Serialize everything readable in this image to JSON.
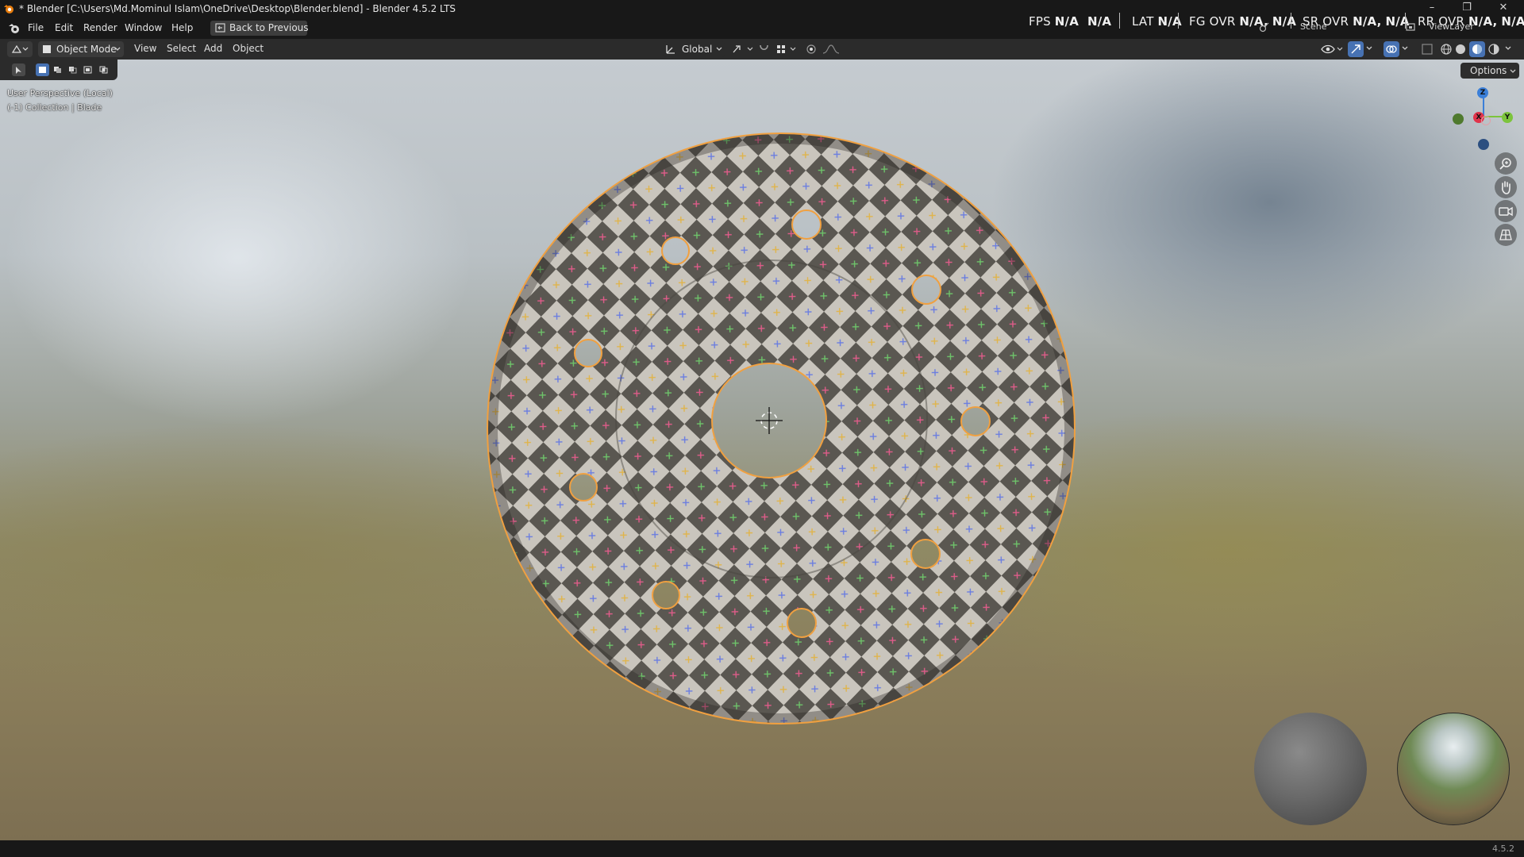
{
  "window": {
    "title": "* Blender [C:\\Users\\Md.Mominul Islam\\OneDrive\\Desktop\\Blender.blend] - Blender 4.5.2 LTS",
    "minimize": "–",
    "maximize": "❐",
    "close": "✕"
  },
  "menu": {
    "items": [
      "File",
      "Edit",
      "Render",
      "Window",
      "Help"
    ],
    "back_button": "Back to Previous"
  },
  "stats": {
    "fps_label": "FPS",
    "fps_v1": "N/A",
    "fps_v2": "N/A",
    "lat_label": "LAT",
    "lat_v": "N/A",
    "fg_label": "FG OVR",
    "fg_v1": "N/A,",
    "fg_v2": "N/A",
    "sr_label": "SR OVR",
    "sr_v1": "N/A,",
    "sr_v2": "N/A",
    "rr_label": "RR OVR",
    "rr_v1": "N/A,",
    "rr_v2": "N/A"
  },
  "scene": {
    "scene_name": "Scene",
    "view_layer": "ViewLayer"
  },
  "header": {
    "mode": "Object Mode",
    "menus": [
      "View",
      "Select",
      "Add",
      "Object"
    ],
    "orientation": "Global"
  },
  "viewport": {
    "options": "Options",
    "perspective": "User Perspective (Local)",
    "collection_info": "(-1) Collection | Blade",
    "gizmo": {
      "x": "X",
      "y": "Y",
      "z": "Z"
    }
  },
  "status": {
    "version": "4.5.2"
  },
  "colors": {
    "selection_outline": "#f0a040",
    "checker_dark": "#5a5751",
    "checker_light": "#c9c5bd",
    "axis_x": "#e0334a",
    "axis_y": "#7cc43c",
    "axis_z": "#3b7fd8"
  }
}
